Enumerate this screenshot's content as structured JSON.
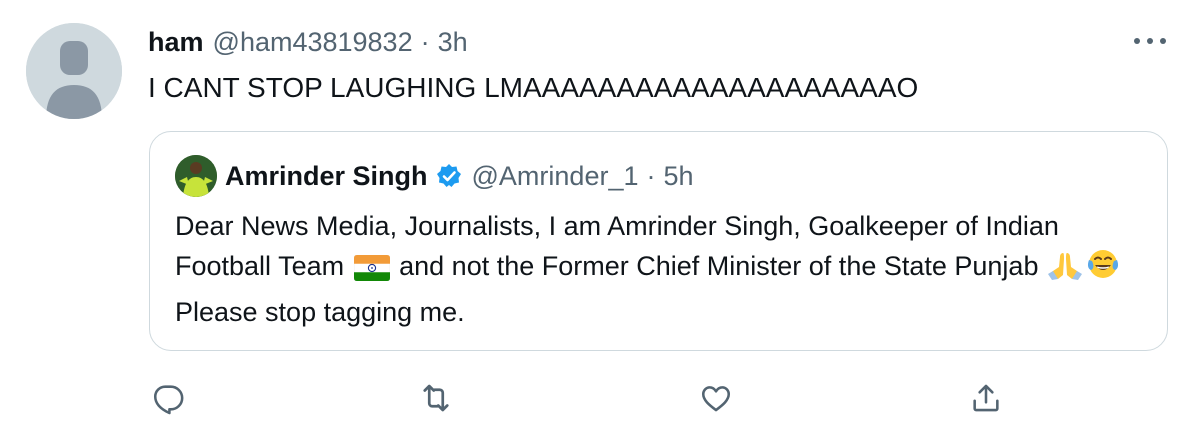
{
  "tweet": {
    "author_name": "ham",
    "author_handle": "@ham43819832",
    "separator": "·",
    "time": "3h",
    "text": "I CANT STOP LAUGHING LMAAAAAAAAAAAAAAAAAAAAO"
  },
  "quote": {
    "author_name": "Amrinder Singh",
    "author_handle": "@Amrinder_1",
    "separator": "·",
    "time": "5h",
    "text_part1": "Dear News Media, Journalists, I am Amrinder Singh, Goalkeeper of Indian Football Team",
    "text_part2": "and not the Former Chief Minister of the State Punjab",
    "text_part3": "Please stop tagging me."
  },
  "icons": {
    "more": "more-options-icon",
    "reply": "reply-icon",
    "retweet": "retweet-icon",
    "like": "like-icon",
    "share": "share-icon",
    "verified": "verified-badge-icon",
    "flag": "india-flag-emoji",
    "pray": "folded-hands-emoji",
    "laugh": "tears-of-joy-emoji"
  },
  "colors": {
    "text": "#0f1419",
    "secondary": "#536471",
    "border": "#cfd9de",
    "verified": "#1d9bf0"
  }
}
